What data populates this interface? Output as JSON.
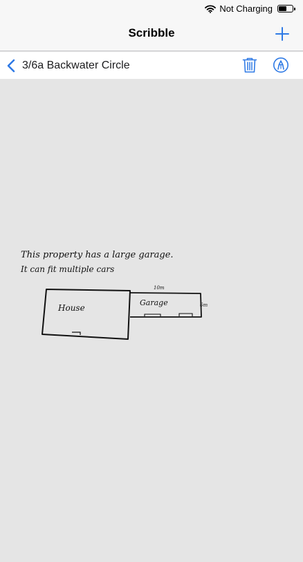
{
  "status_bar": {
    "charging_text": "Not Charging",
    "wifi_icon": "wifi-icon",
    "battery_icon": "battery-icon",
    "battery_level": 0.6
  },
  "nav": {
    "title": "Scribble",
    "add_icon": "plus-icon"
  },
  "toolbar": {
    "back_icon": "chevron-left-icon",
    "back_label": "3/6a Backwater Circle",
    "trash_icon": "trash-icon",
    "pen_icon": "pen-circle-icon"
  },
  "sketch": {
    "note_line_1": "This property has a large garage.",
    "note_line_2": "It can fit multiple cars",
    "house_label": "House",
    "garage_label": "Garage",
    "dimension_top": "10m",
    "dimension_side": "6m"
  },
  "colors": {
    "accent": "#2f7ae5",
    "ink": "#111111",
    "canvas": "#e5e5e5"
  }
}
